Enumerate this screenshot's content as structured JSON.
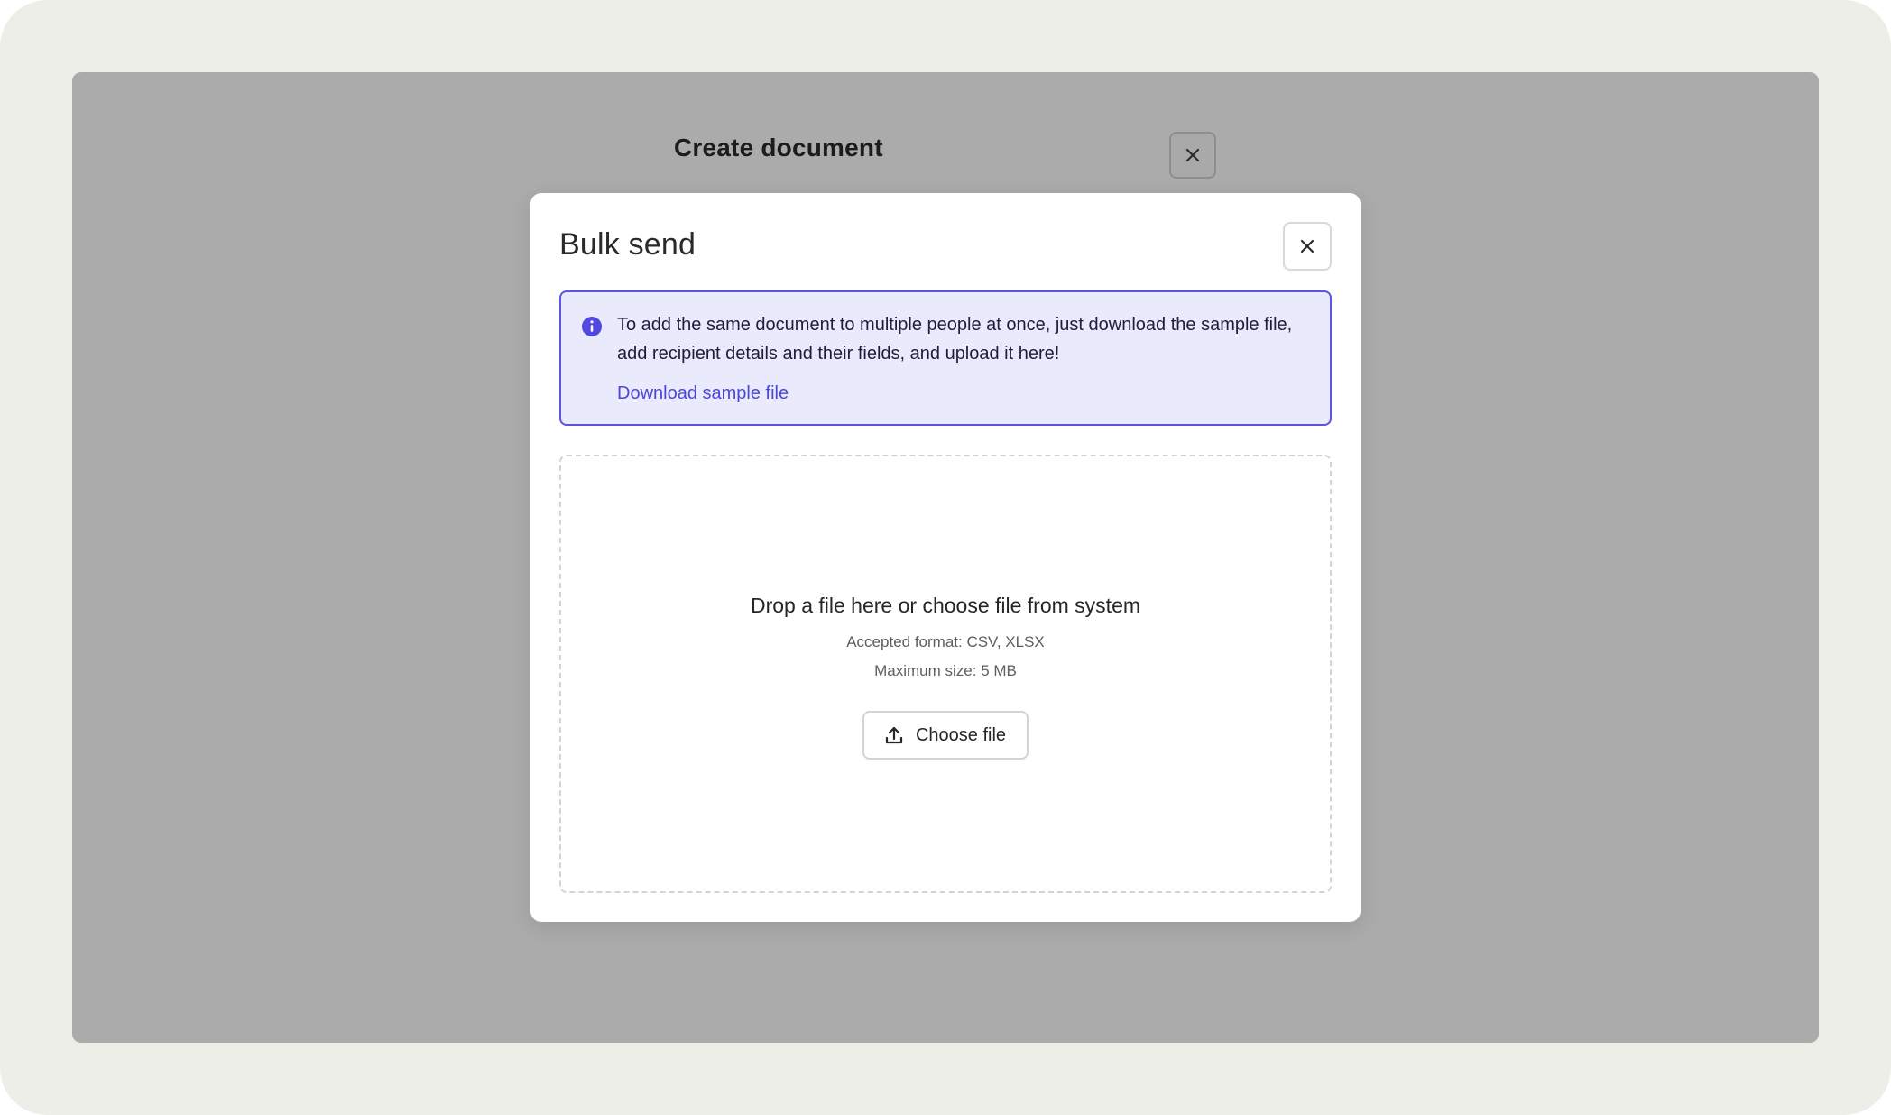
{
  "background_dialog": {
    "title": "Create document",
    "close_icon": "close-icon"
  },
  "modal": {
    "title": "Bulk send",
    "close_icon": "close-icon",
    "info": {
      "icon": "info-icon",
      "text": "To add the same document to multiple people at once, just download the sample file, add recipient details and their fields, and upload it here!",
      "link_label": "Download sample file"
    },
    "dropzone": {
      "title": "Drop a file here or choose file from system",
      "format_text": "Accepted format: CSV, XLSX",
      "size_text": "Maximum size: 5 MB",
      "button_label": "Choose file",
      "button_icon": "upload-icon"
    }
  },
  "colors": {
    "accent": "#5b54e6",
    "link": "#4c46d8",
    "info_background": "#e9eafc",
    "overlay": "#ababab",
    "frame": "#eeeee9"
  }
}
